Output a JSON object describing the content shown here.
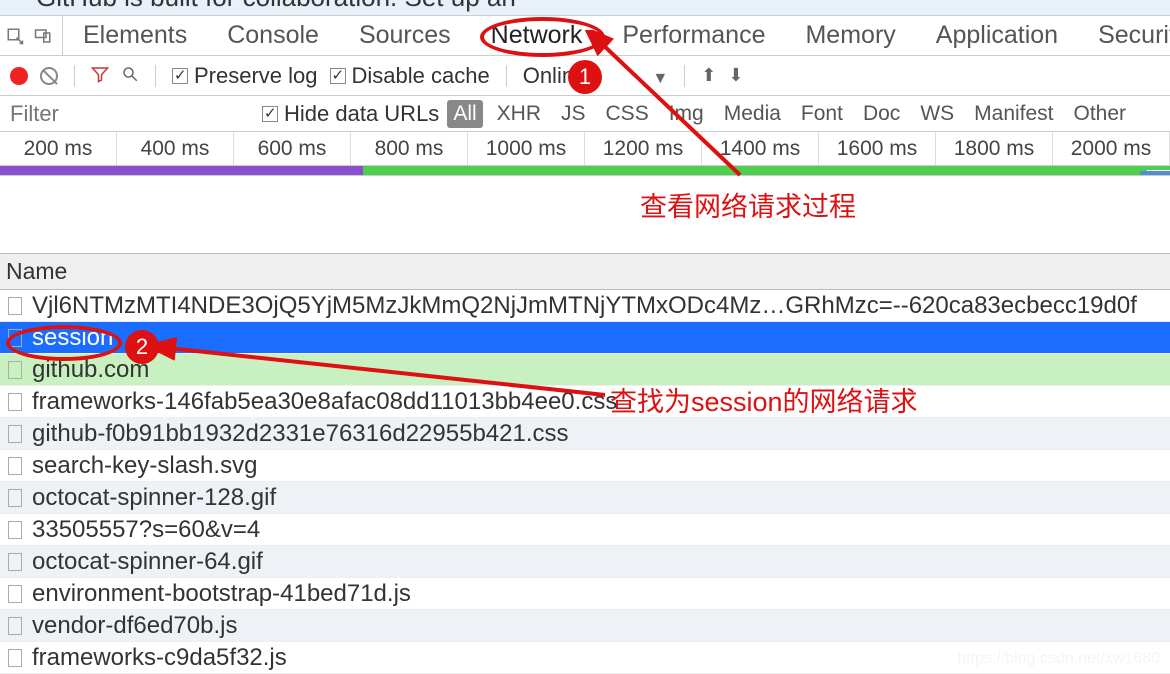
{
  "banner": {
    "text": "GitHub is built for collaboration. Set up an"
  },
  "tabs": {
    "items": [
      {
        "label": "Elements"
      },
      {
        "label": "Console"
      },
      {
        "label": "Sources"
      },
      {
        "label": "Network"
      },
      {
        "label": "Performance"
      },
      {
        "label": "Memory"
      },
      {
        "label": "Application"
      },
      {
        "label": "Security"
      }
    ]
  },
  "toolbar": {
    "preserve_log": "Preserve log",
    "disable_cache": "Disable cache",
    "online_label": "Online"
  },
  "filterbar": {
    "placeholder": "Filter",
    "hide_data_urls": "Hide data URLs",
    "chips": [
      "All",
      "XHR",
      "JS",
      "CSS",
      "Img",
      "Media",
      "Font",
      "Doc",
      "WS",
      "Manifest",
      "Other"
    ]
  },
  "timeline": {
    "ticks": [
      "200 ms",
      "400 ms",
      "600 ms",
      "800 ms",
      "1000 ms",
      "1200 ms",
      "1400 ms",
      "1600 ms",
      "1800 ms",
      "2000 ms"
    ]
  },
  "list": {
    "header": "Name",
    "rows": [
      {
        "name": "Vjl6NTMzMTI4NDE3OjQ5YjM5MzJkMmQ2NjJmMTNjYTMxODc4Mz…GRhMzc=--620ca83ecbecc19d0f",
        "class": ""
      },
      {
        "name": "session",
        "class": "selected"
      },
      {
        "name": "github.com",
        "class": "highlight"
      },
      {
        "name": "frameworks-146fab5ea30e8afac08dd11013bb4ee0.css",
        "class": ""
      },
      {
        "name": "github-f0b91bb1932d2331e76316d22955b421.css",
        "class": "alt"
      },
      {
        "name": "search-key-slash.svg",
        "class": ""
      },
      {
        "name": "octocat-spinner-128.gif",
        "class": "alt"
      },
      {
        "name": "33505557?s=60&v=4",
        "class": ""
      },
      {
        "name": "octocat-spinner-64.gif",
        "class": "alt"
      },
      {
        "name": "environment-bootstrap-41bed71d.js",
        "class": ""
      },
      {
        "name": "vendor-df6ed70b.js",
        "class": "alt"
      },
      {
        "name": "frameworks-c9da5f32.js",
        "class": ""
      }
    ]
  },
  "annotations": {
    "num1": "1",
    "num2": "2",
    "text1": "查看网络请求过程",
    "text2": "查找为session的网络请求"
  },
  "watermark": "https://blog.csdn.net/xw1680"
}
